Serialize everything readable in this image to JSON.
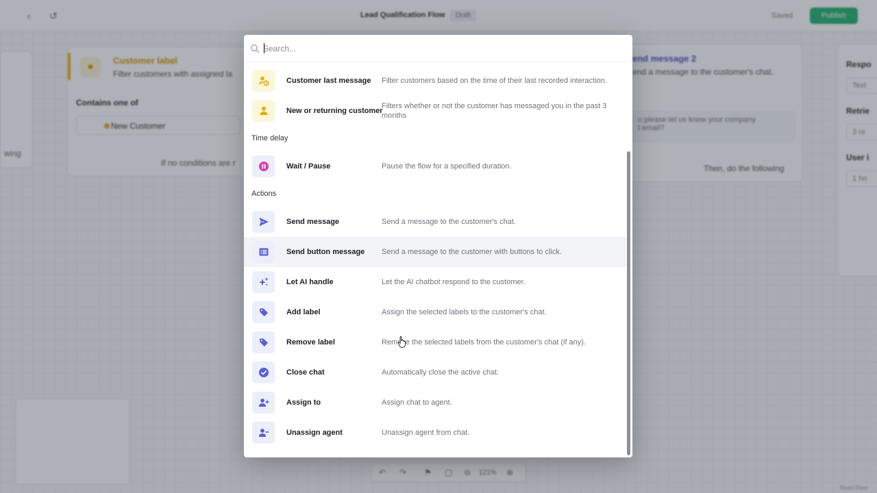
{
  "background": {
    "flow_title": "Lead Qualification Flow",
    "draft_badge": "Draft",
    "saved_label": "Saved",
    "publish_label": "Publish",
    "left_node": {
      "side_label": "wing"
    },
    "node_a": {
      "title": "Customer label",
      "subtitle": "Filter customers with assigned la",
      "condition": "Contains one of",
      "chip_value": "New Customer",
      "footer": "If no conditions are r"
    },
    "node_b": {
      "title": "end message 2",
      "subtitle": "end a message to the customer's chat.",
      "message_line1": "u please let us know your company",
      "message_line2": "t email?",
      "footer": "Then, do the following"
    },
    "node_c": {
      "field1": "Respo",
      "value1": "Text",
      "field2": "Retrie",
      "value2": "3 re",
      "field3": "User i",
      "value3": "1 ho"
    },
    "zoom": "121%",
    "react_flow_tag": "React Flow"
  },
  "search": {
    "placeholder": "Search...",
    "value": ""
  },
  "sections": {
    "time_delay": "Time delay",
    "actions": "Actions"
  },
  "items": [
    {
      "name": "Customer last message",
      "description": "Filter customers based on the time of their last recorded interaction.",
      "icon": "user-clock-icon"
    },
    {
      "name": "New or returning customer",
      "description": "Filters whether or not the customer has messaged you in the past 3 months",
      "icon": "user-icon"
    },
    {
      "name": "Wait / Pause",
      "description": "Pause the flow for a specified duration.",
      "icon": "pause-icon"
    },
    {
      "name": "Send message",
      "description": "Send a message to the customer's chat.",
      "icon": "send-icon"
    },
    {
      "name": "Send button message",
      "description": "Send a message to the customer with buttons to click.",
      "icon": "list-icon"
    },
    {
      "name": "Let AI handle",
      "description": "Let the AI chatbot respond to the customer.",
      "icon": "sparkles-icon"
    },
    {
      "name": "Add label",
      "description": "Assign the selected labels to the customer's chat.",
      "icon": "tag-icon"
    },
    {
      "name": "Remove label",
      "description": "Remove the selected labels from the customer's chat (if any).",
      "icon": "tag-icon"
    },
    {
      "name": "Close chat",
      "description": "Automatically close the active chat.",
      "icon": "check-circle-icon"
    },
    {
      "name": "Assign to",
      "description": "Assign chat to agent.",
      "icon": "user-plus-icon"
    },
    {
      "name": "Unassign agent",
      "description": "Unassign agent from chat.",
      "icon": "user-minus-icon"
    }
  ],
  "colors": {
    "accent_purple": "#5b5fd6",
    "accent_yellow": "#e2b100",
    "pause_magenta": "#d63fb0",
    "publish_green": "#2bb673"
  }
}
